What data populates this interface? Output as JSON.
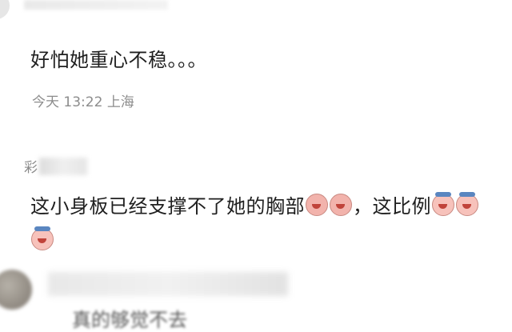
{
  "comments": [
    {
      "text": "好怕她重心不稳。。。",
      "time": "今天 13:22",
      "location": "上海"
    },
    {
      "username_visible": "彩",
      "text": "这小身板已经支撑不了她的胸部",
      "text_after_emoji": "，这比例",
      "emoji_names": [
        "laughing-face-icon",
        "laughing-face-icon",
        "crying-face-icon",
        "crying-face-icon",
        "crying-face-icon"
      ]
    },
    {
      "partial_text": "真的够觉不去"
    }
  ]
}
